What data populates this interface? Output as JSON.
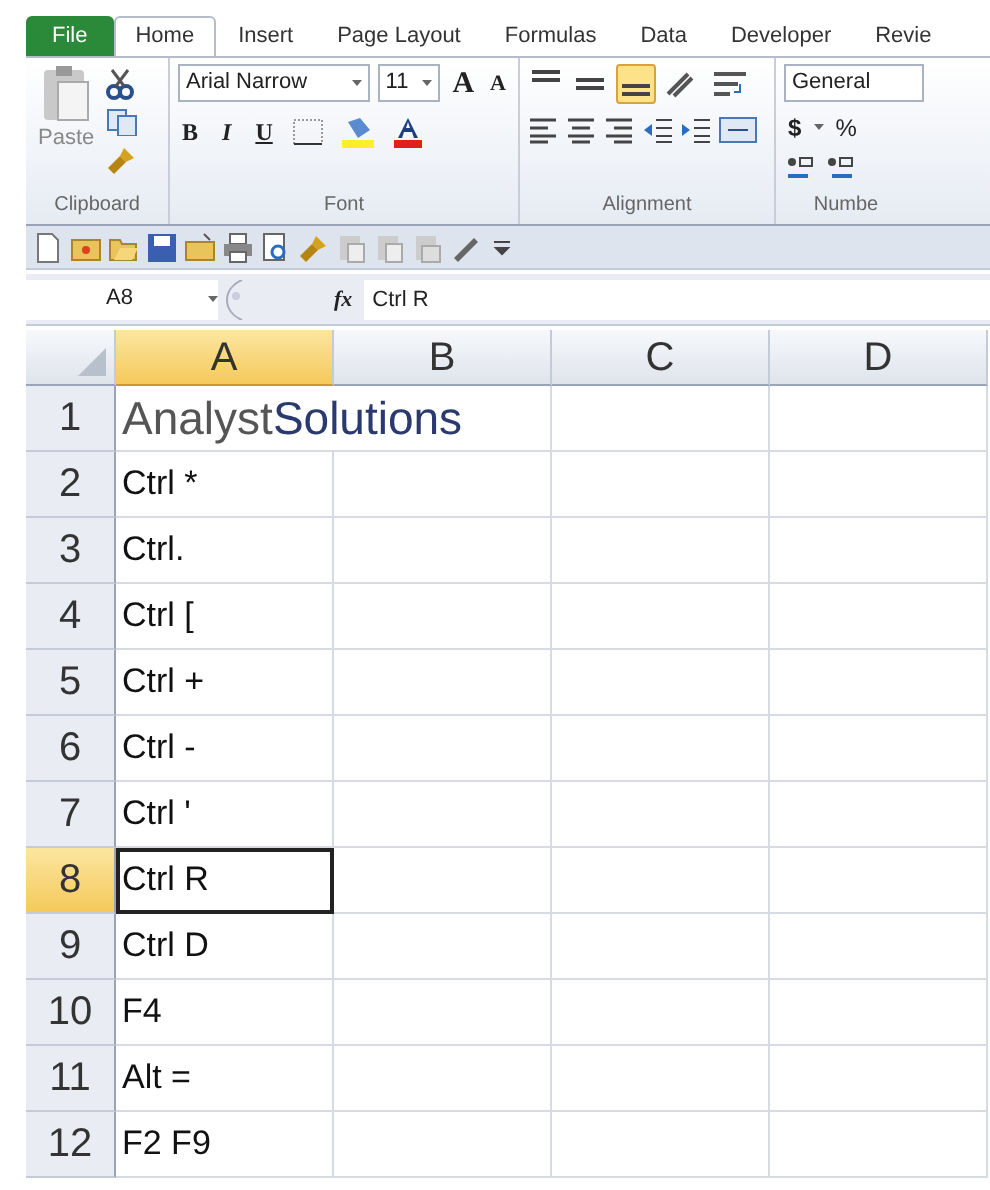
{
  "ribbon_tabs": [
    {
      "label": "File",
      "kind": "file",
      "selected": false
    },
    {
      "label": "Home",
      "kind": "tab",
      "selected": true
    },
    {
      "label": "Insert",
      "kind": "tab",
      "selected": false
    },
    {
      "label": "Page Layout",
      "kind": "tab",
      "selected": false
    },
    {
      "label": "Formulas",
      "kind": "tab",
      "selected": false
    },
    {
      "label": "Data",
      "kind": "tab",
      "selected": false
    },
    {
      "label": "Developer",
      "kind": "tab",
      "selected": false
    },
    {
      "label": "Revie",
      "kind": "tab",
      "selected": false
    }
  ],
  "clipboard": {
    "paste": "Paste",
    "group_label": "Clipboard"
  },
  "font": {
    "font_name": "Arial Narrow",
    "font_size": "11",
    "grow": "A",
    "shrink": "A",
    "bold": "B",
    "italic": "I",
    "underline": "U",
    "group_label": "Font"
  },
  "alignment": {
    "vertical_buttons": [
      {
        "selected": false
      },
      {
        "selected": false
      },
      {
        "selected": true
      }
    ],
    "group_label": "Alignment"
  },
  "number": {
    "format": "General",
    "currency": "$",
    "percent": "%",
    "group_label": "Numbe"
  },
  "formula_bar": {
    "name_box": "A8",
    "fx": "fx",
    "value": "Ctrl R"
  },
  "columns": [
    {
      "label": "A",
      "selected": true
    },
    {
      "label": "B",
      "selected": false
    },
    {
      "label": "C",
      "selected": false
    },
    {
      "label": "D",
      "selected": false
    }
  ],
  "rows": [
    {
      "number": "1",
      "selected": false,
      "kind": "logo",
      "logo": [
        "Analyst",
        "Solutions"
      ]
    },
    {
      "number": "2",
      "selected": false,
      "kind": "text",
      "value": "Ctrl *"
    },
    {
      "number": "3",
      "selected": false,
      "kind": "text",
      "value": "Ctrl."
    },
    {
      "number": "4",
      "selected": false,
      "kind": "text",
      "value": "Ctrl ["
    },
    {
      "number": "5",
      "selected": false,
      "kind": "text",
      "value": "Ctrl +"
    },
    {
      "number": "6",
      "selected": false,
      "kind": "text",
      "value": "Ctrl -"
    },
    {
      "number": "7",
      "selected": false,
      "kind": "text",
      "value": "Ctrl '"
    },
    {
      "number": "8",
      "selected": true,
      "kind": "text",
      "value": "Ctrl R"
    },
    {
      "number": "9",
      "selected": false,
      "kind": "text",
      "value": "Ctrl D"
    },
    {
      "number": "10",
      "selected": false,
      "kind": "text",
      "value": "F4"
    },
    {
      "number": "11",
      "selected": false,
      "kind": "text",
      "value": "Alt ="
    },
    {
      "number": "12",
      "selected": false,
      "kind": "text",
      "value": "F2 F9"
    }
  ]
}
